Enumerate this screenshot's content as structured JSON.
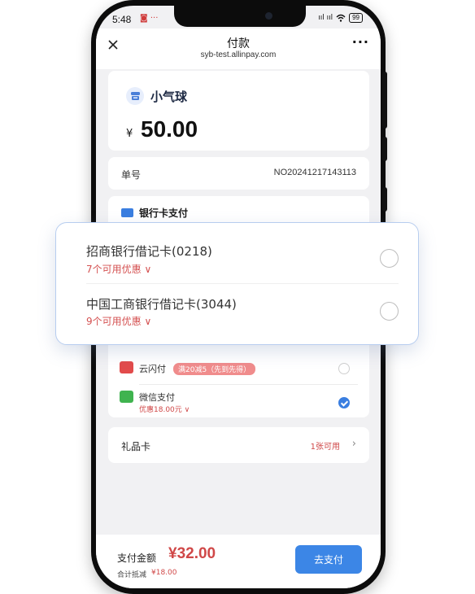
{
  "status_bar": {
    "time": "5:48",
    "left_icons": "◙ ···",
    "signal": "ııl ııl",
    "battery": "99"
  },
  "nav": {
    "title": "付款",
    "subtitle": "syb-test.allinpay.com",
    "more": "···"
  },
  "merchant": {
    "name": "小气球",
    "currency_symbol": "¥",
    "amount": "50.00"
  },
  "order": {
    "label": "单号",
    "value": "NO20241217143113"
  },
  "pay_methods": {
    "header": "银行卡支付",
    "items": [
      {
        "name": "云闪付",
        "tag": "满20减5（先到先得）",
        "checked": false
      },
      {
        "name": "微信支付",
        "sub": "优惠18.00元 ∨",
        "checked": true
      }
    ]
  },
  "bank_card_popup": {
    "cards": [
      {
        "name": "招商银行借记卡(0218)",
        "promo": "7个可用优惠 ∨"
      },
      {
        "name": "中国工商银行借记卡(3044)",
        "promo": "9个可用优惠 ∨"
      }
    ]
  },
  "gift_card": {
    "label": "礼品卡",
    "count": "1张可用",
    "arrow": "›"
  },
  "bottom_bar": {
    "pay_label": "支付金额",
    "pay_amount": "¥32.00",
    "discount_label": "合计抵减",
    "discount_value": "¥18.00",
    "pay_button": "去支付"
  },
  "colors": {
    "accent": "#3c86e6",
    "price_red": "#d04848",
    "popup_border": "#b7cdef"
  }
}
